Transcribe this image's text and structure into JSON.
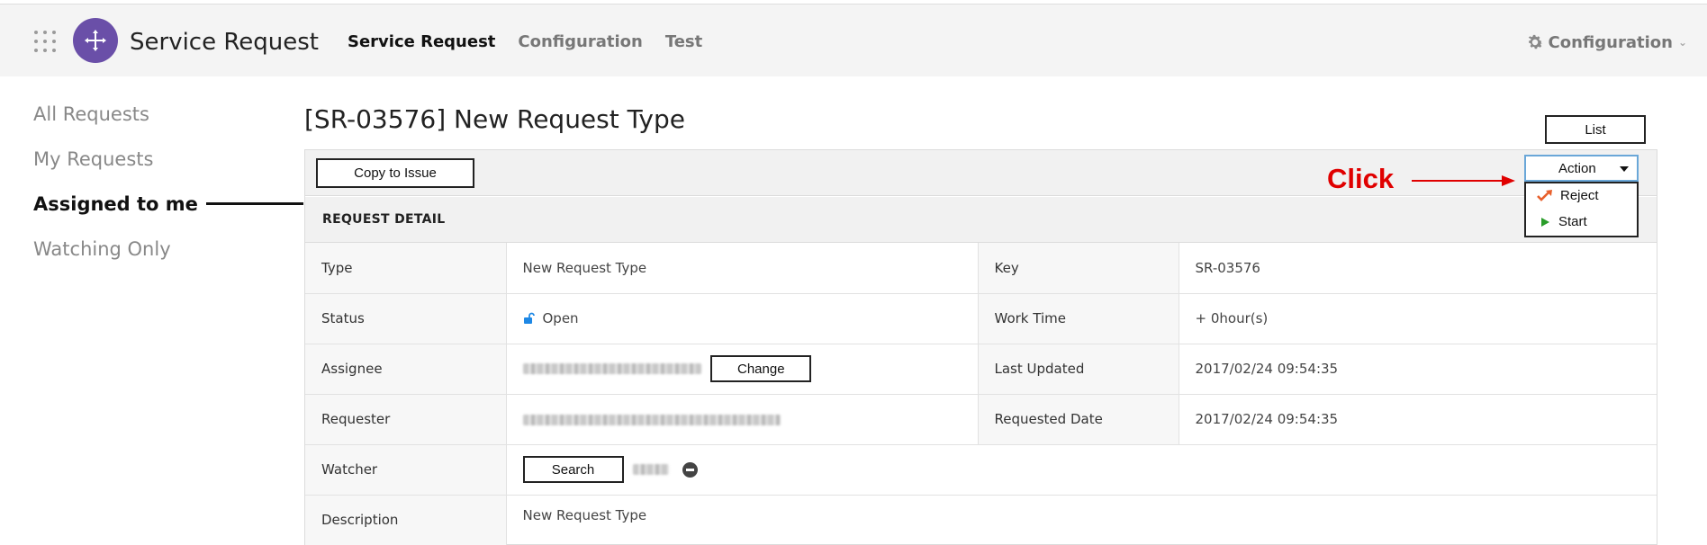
{
  "header": {
    "app_title": "Service Request",
    "nav": [
      {
        "label": "Service Request",
        "active": true
      },
      {
        "label": "Configuration",
        "active": false
      },
      {
        "label": "Test",
        "active": false
      }
    ],
    "right_menu_label": "Configuration",
    "icons": {
      "apps": "apps-grid-icon",
      "logo": "service-request-logo",
      "settings": "gear-icon"
    }
  },
  "sidebar": {
    "items": [
      {
        "label": "All Requests",
        "active": false
      },
      {
        "label": "My Requests",
        "active": false
      },
      {
        "label": "Assigned to me",
        "active": true
      },
      {
        "label": "Watching Only",
        "active": false
      }
    ]
  },
  "main": {
    "title": "[SR-03576] New Request Type",
    "list_button": "List",
    "copy_button": "Copy to Issue",
    "section_title": "REQUEST DETAIL",
    "action": {
      "label": "Action",
      "menu": [
        {
          "label": "Reject",
          "icon": "reject-arrow-icon",
          "color": "#e8602c"
        },
        {
          "label": "Start",
          "icon": "play-icon",
          "color": "#2a9d2a"
        }
      ]
    },
    "details": {
      "type_label": "Type",
      "type_value": "New Request Type",
      "key_label": "Key",
      "key_value": "SR-03576",
      "status_label": "Status",
      "status_value": "Open",
      "work_time_label": "Work Time",
      "work_time_value": "+ 0hour(s)",
      "assignee_label": "Assignee",
      "change_button": "Change",
      "last_updated_label": "Last Updated",
      "last_updated_value": "2017/02/24 09:54:35",
      "requester_label": "Requester",
      "requested_date_label": "Requested Date",
      "requested_date_value": "2017/02/24 09:54:35",
      "watcher_label": "Watcher",
      "search_button": "Search",
      "description_label": "Description",
      "description_value": "New Request Type"
    }
  },
  "annotation": {
    "text": "Click",
    "color": "#e00000"
  },
  "colors": {
    "brand": "#6a4fa8",
    "header_bg": "#f4f4f4",
    "action_border": "#6aa7d8",
    "status_lock": "#1e88e5"
  }
}
